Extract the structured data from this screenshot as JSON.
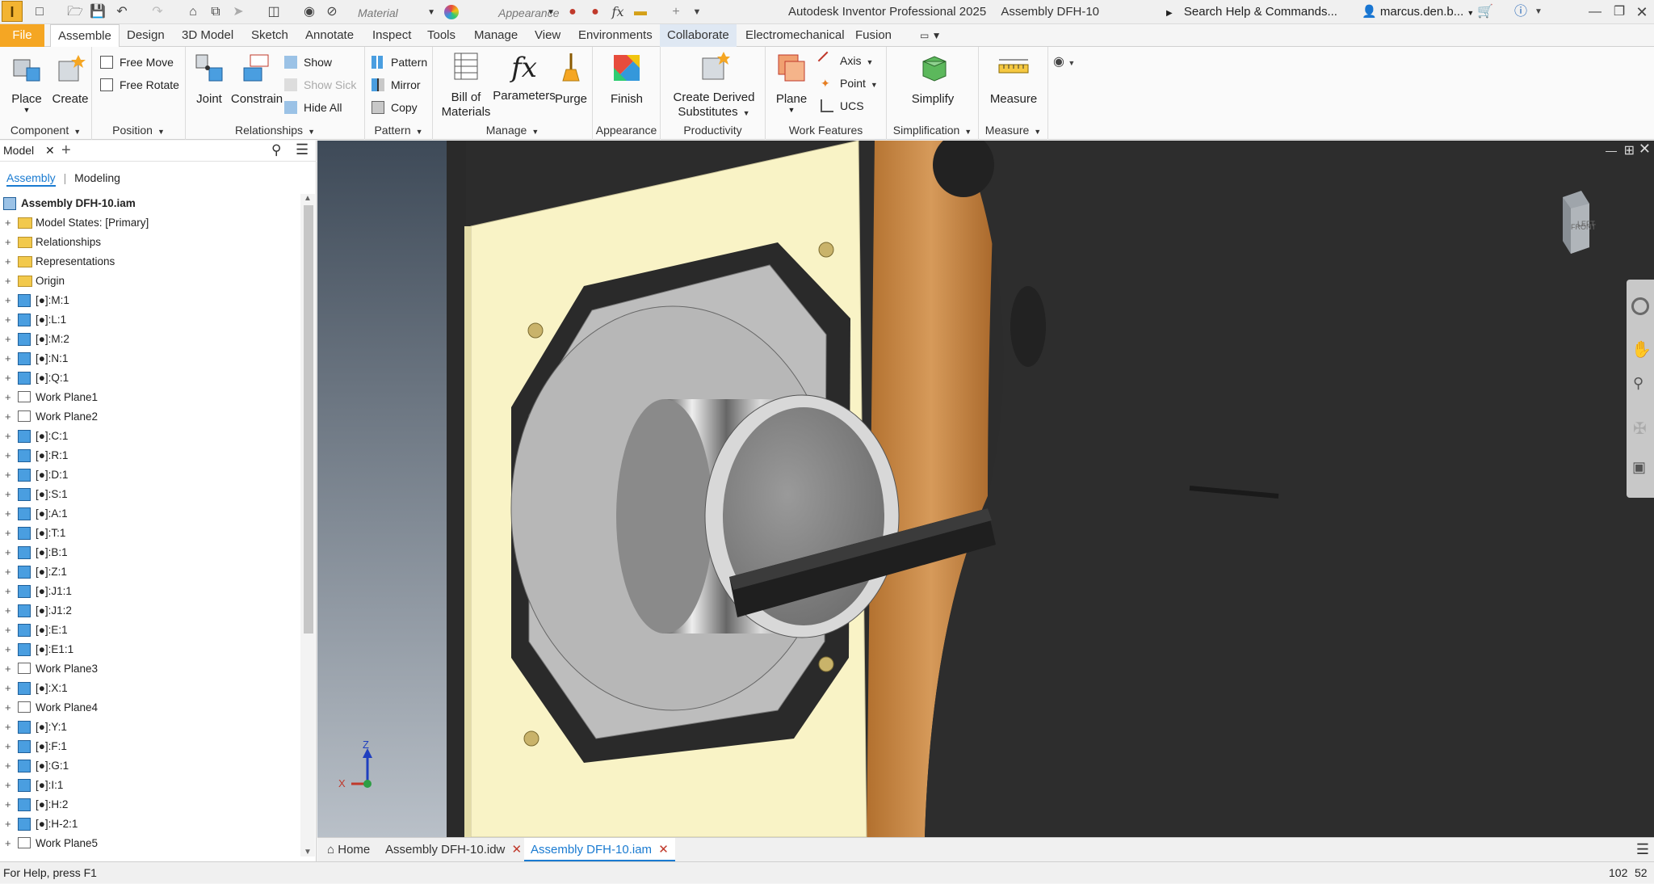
{
  "titlebar": {
    "material_placeholder": "Material",
    "appearance_placeholder": "Appearance",
    "app_title": "Autodesk Inventor Professional 2025",
    "document_title": "Assembly DFH-10",
    "search_label": "Search Help & Commands...",
    "user_name": "marcus.den.b..."
  },
  "ribbon_tabs": [
    {
      "label": "File"
    },
    {
      "label": "Assemble"
    },
    {
      "label": "Design"
    },
    {
      "label": "3D Model"
    },
    {
      "label": "Sketch"
    },
    {
      "label": "Annotate"
    },
    {
      "label": "Inspect"
    },
    {
      "label": "Tools"
    },
    {
      "label": "Manage"
    },
    {
      "label": "View"
    },
    {
      "label": "Environments"
    },
    {
      "label": "Collaborate"
    },
    {
      "label": "Electromechanical"
    },
    {
      "label": "Fusion"
    }
  ],
  "ribbon": {
    "component": {
      "label": "Component",
      "place": "Place",
      "create": "Create"
    },
    "position": {
      "label": "Position",
      "free_move": "Free Move",
      "free_rotate": "Free Rotate"
    },
    "relationships": {
      "label": "Relationships",
      "joint": "Joint",
      "constrain": "Constrain",
      "show": "Show",
      "show_sick": "Show Sick",
      "hide_all": "Hide All"
    },
    "pattern": {
      "label": "Pattern",
      "pattern": "Pattern",
      "mirror": "Mirror",
      "copy": "Copy"
    },
    "manage": {
      "label": "Manage",
      "bom_line1": "Bill of",
      "bom_line2": "Materials",
      "parameters": "Parameters",
      "purge": "Purge"
    },
    "appearance": {
      "label": "Appearance",
      "finish": "Finish"
    },
    "productivity": {
      "label": "Productivity",
      "derived_line1": "Create Derived",
      "derived_line2": "Substitutes"
    },
    "work_features": {
      "label": "Work Features",
      "plane": "Plane",
      "axis": "Axis",
      "point": "Point",
      "ucs": "UCS"
    },
    "simplification": {
      "label": "Simplification",
      "simplify": "Simplify"
    },
    "measure": {
      "label": "Measure",
      "measure": "Measure"
    }
  },
  "browser": {
    "tab_label": "Model",
    "view_assembly": "Assembly",
    "view_modeling": "Modeling",
    "root": "Assembly DFH-10.iam",
    "nodes": [
      {
        "label": "Model States: [Primary]",
        "icon": "folder"
      },
      {
        "label": "Relationships",
        "icon": "folder"
      },
      {
        "label": "Representations",
        "icon": "folder-rep"
      },
      {
        "label": "Origin",
        "icon": "folder"
      },
      {
        "label": "[●]:M:1",
        "icon": "part"
      },
      {
        "label": "[●]:L:1",
        "icon": "part"
      },
      {
        "label": "[●]:M:2",
        "icon": "part"
      },
      {
        "label": "[●]:N:1",
        "icon": "part"
      },
      {
        "label": "[●]:Q:1",
        "icon": "part"
      },
      {
        "label": "Work Plane1",
        "icon": "plane"
      },
      {
        "label": "Work Plane2",
        "icon": "plane"
      },
      {
        "label": "[●]:C:1",
        "icon": "part"
      },
      {
        "label": "[●]:R:1",
        "icon": "part"
      },
      {
        "label": "[●]:D:1",
        "icon": "part"
      },
      {
        "label": "[●]:S:1",
        "icon": "part"
      },
      {
        "label": "[●]:A:1",
        "icon": "part"
      },
      {
        "label": "[●]:T:1",
        "icon": "part"
      },
      {
        "label": "[●]:B:1",
        "icon": "part"
      },
      {
        "label": "[●]:Z:1",
        "icon": "part"
      },
      {
        "label": "[●]:J1:1",
        "icon": "part"
      },
      {
        "label": "[●]:J1:2",
        "icon": "part"
      },
      {
        "label": "[●]:E:1",
        "icon": "part"
      },
      {
        "label": "[●]:E1:1",
        "icon": "part"
      },
      {
        "label": "Work Plane3",
        "icon": "plane"
      },
      {
        "label": "[●]:X:1",
        "icon": "part"
      },
      {
        "label": "Work Plane4",
        "icon": "plane"
      },
      {
        "label": "[●]:Y:1",
        "icon": "part"
      },
      {
        "label": "[●]:F:1",
        "icon": "part"
      },
      {
        "label": "[●]:G:1",
        "icon": "part"
      },
      {
        "label": "[●]:I:1",
        "icon": "part"
      },
      {
        "label": "[●]:H:2",
        "icon": "part"
      },
      {
        "label": "[●]:H-2:1",
        "icon": "part"
      },
      {
        "label": "Work Plane5",
        "icon": "plane"
      }
    ]
  },
  "viewcube": {
    "face_front": "FRONT",
    "face_left": "LEFT"
  },
  "doc_tabs": [
    {
      "label": "Home"
    },
    {
      "label": "Assembly DFH-10.idw"
    },
    {
      "label": "Assembly DFH-10.iam"
    }
  ],
  "status": {
    "help": "For Help, press F1",
    "n1": "102",
    "n2": "52"
  },
  "colors": {
    "file_tab": "#f5a623",
    "accent": "#1a7bd1",
    "backplate": "#f9f3c6",
    "wood": "#c8853f",
    "dark_surface": "#2c2c2c"
  }
}
